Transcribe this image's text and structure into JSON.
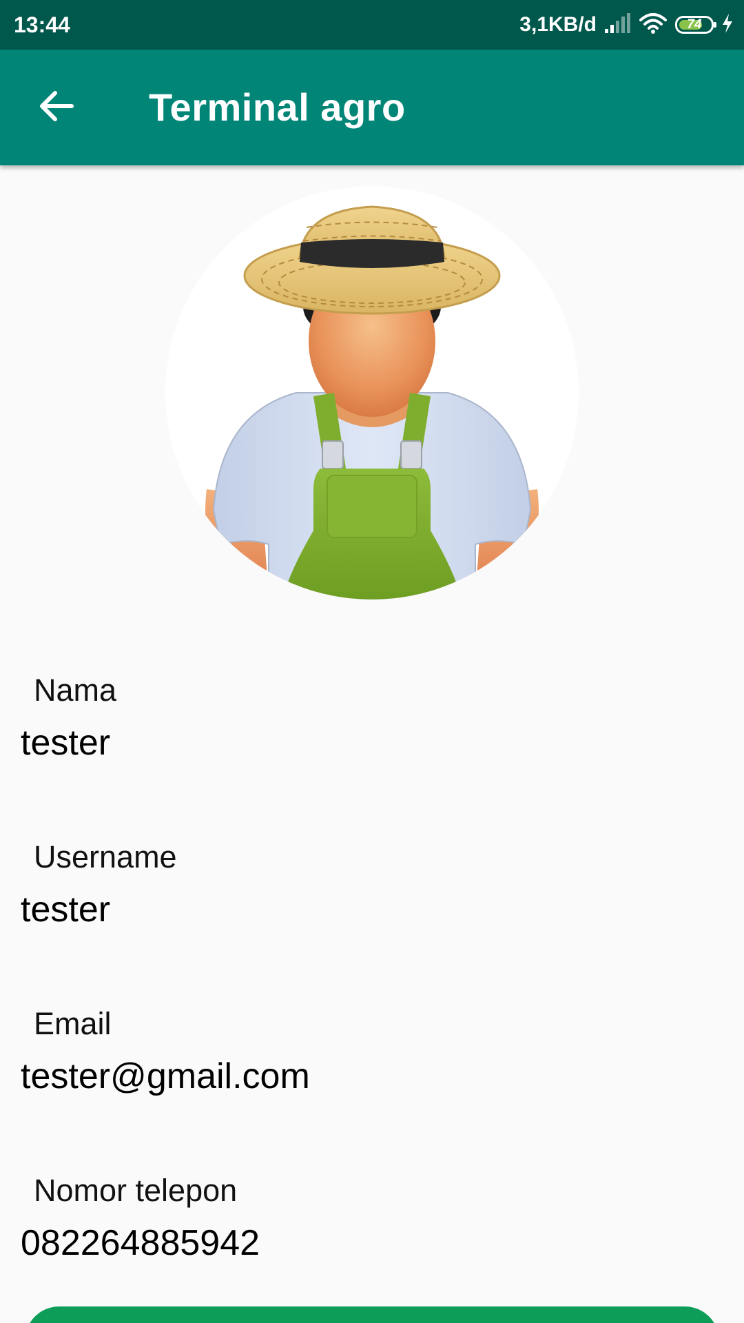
{
  "status_bar": {
    "time": "13:44",
    "network_speed": "3,1KB/d",
    "battery_level": "74",
    "battery_fraction": 0.74
  },
  "app_bar": {
    "title": "Terminal agro",
    "back_icon": "arrow-back-icon"
  },
  "avatar": {
    "icon": "farmer-avatar"
  },
  "profile": {
    "name_label": "Nama",
    "name_value": "tester",
    "username_label": "Username",
    "username_value": "tester",
    "email_label": "Email",
    "email_value": "tester@gmail.com",
    "phone_label": "Nomor telepon",
    "phone_value": "082264885942"
  },
  "colors": {
    "status_bar": "#00574b",
    "app_bar": "#008577",
    "background": "#fafafa",
    "button": "#0e9d58"
  }
}
